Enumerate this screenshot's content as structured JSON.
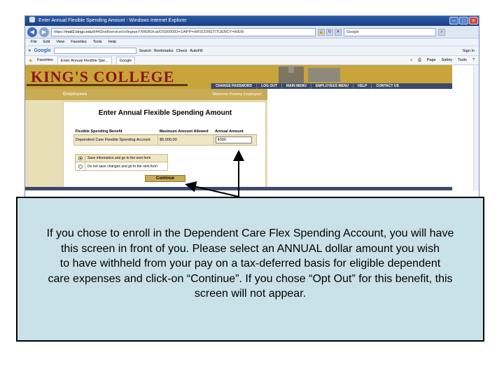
{
  "browser": {
    "title": "Enter Annual Flexible Spending Amount - Windows Internet Explorer",
    "url_prefix": "https://",
    "url_host": "mail2.kings.edu",
    "url_rest": "/8443/selfservice/collegeprY/WEB0/cat/OS000083=1/APP=HRSCONSTITUENCY=WEM",
    "search_label": "Google",
    "menu": [
      "File",
      "Edit",
      "View",
      "Favorites",
      "Tools",
      "Help"
    ],
    "googlebar": {
      "logo": "Google",
      "search": "Search",
      "bookmarks": "Bookmarks",
      "check": "Check",
      "autofill": "AutoFill",
      "sign_in": "Sign In"
    },
    "favorites": "Favorites",
    "tabs": [
      "Enter Annual Flexible Spe...",
      "Google"
    ],
    "fav_tools": [
      "Page",
      "Safety",
      "Tools"
    ]
  },
  "site": {
    "logo": "KING'S COLLEGE",
    "nav": [
      "CHANGE PASSWORD",
      "LOG OUT",
      "MAIN MENU",
      "EMPLOYEES MENU",
      "HELP",
      "CONTACT US"
    ],
    "section": "Employees",
    "welcome": "Welcome Dummy Employee!"
  },
  "form": {
    "title": "Enter Annual Flexible Spending Amount",
    "headers": [
      "Flexible Spending Benefit",
      "Maximum Amount Allowed",
      "Annual Amount"
    ],
    "row": {
      "benefit": "Dependent Care Flexible Spending Account",
      "max": "$5,000.00",
      "amount": "4000"
    },
    "options": [
      "Save information and go to the next form",
      "Do not save changes and go to the next form"
    ],
    "continue_label": "Continue"
  },
  "caption": "If you chose to enroll in the Dependent Care Flex Spending Account, you will have\nthis screen in front of you.  Please select an ANNUAL dollar amount you wish\nto have withheld from your pay on a tax-deferred basis for eligible dependent\ncare expenses and click-on “Continue”.  If you chose “Opt Out” for this benefit, this\nscreen will not appear."
}
